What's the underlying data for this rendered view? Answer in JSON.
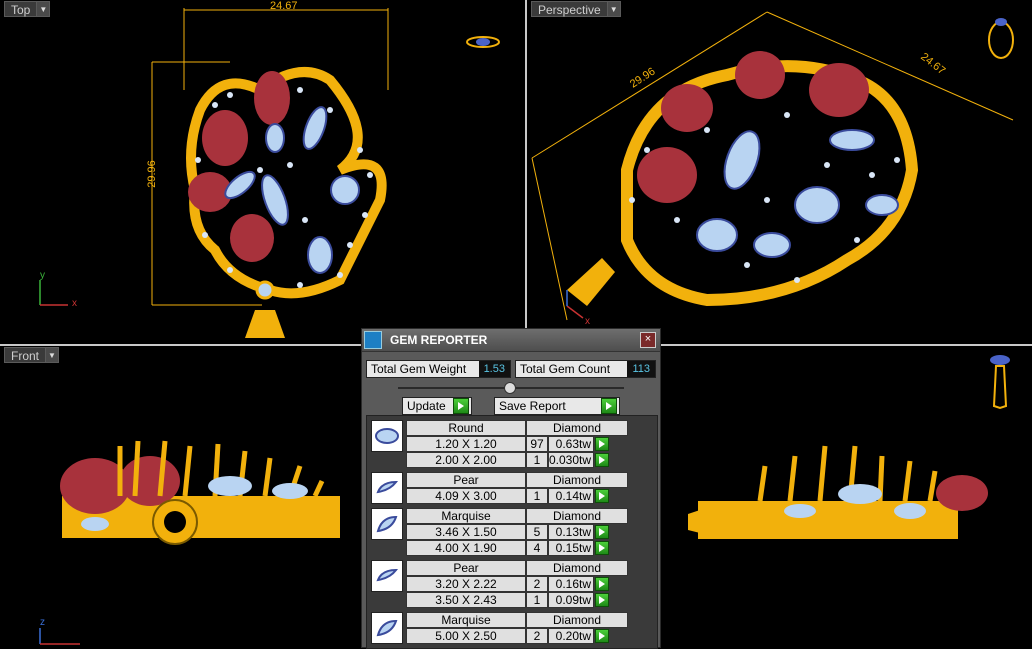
{
  "viewports": {
    "top": {
      "label": "Top",
      "dim_width": "24.67",
      "dim_height": "29.96",
      "axis_y": "y",
      "axis_x": "x"
    },
    "perspective": {
      "label": "Perspective",
      "dim_a": "29.96",
      "dim_b": "24.67",
      "axis_x": "x"
    },
    "front": {
      "label": "Front",
      "axis_z": "z"
    }
  },
  "gem_reporter": {
    "title": "GEM REPORTER",
    "close": "×",
    "total_weight_label": "Total Gem Weight",
    "total_weight_value": "1.53",
    "total_count_label": "Total Gem Count",
    "total_count_value": "113",
    "update_label": "Update",
    "save_label": "Save Report",
    "groups": [
      {
        "icon": "round-gem-icon",
        "shape": "Round",
        "material": "Diamond",
        "rows": [
          {
            "size": "1.20 X 1.20",
            "count": "97",
            "tw": "0.63tw"
          },
          {
            "size": "2.00 X 2.00",
            "count": "1",
            "tw": "0.030tw"
          }
        ]
      },
      {
        "icon": "pear-gem-icon",
        "shape": "Pear",
        "material": "Diamond",
        "rows": [
          {
            "size": "4.09 X 3.00",
            "count": "1",
            "tw": "0.14tw"
          }
        ]
      },
      {
        "icon": "marquise-gem-icon",
        "shape": "Marquise",
        "material": "Diamond",
        "rows": [
          {
            "size": "3.46 X 1.50",
            "count": "5",
            "tw": "0.13tw"
          },
          {
            "size": "4.00 X 1.90",
            "count": "4",
            "tw": "0.15tw"
          }
        ]
      },
      {
        "icon": "pear-gem-icon",
        "shape": "Pear",
        "material": "Diamond",
        "rows": [
          {
            "size": "3.20 X 2.22",
            "count": "2",
            "tw": "0.16tw"
          },
          {
            "size": "3.50 X 2.43",
            "count": "1",
            "tw": "0.09tw"
          }
        ]
      },
      {
        "icon": "marquise-gem-icon",
        "shape": "Marquise",
        "material": "Diamond",
        "rows": [
          {
            "size": "5.00 X 2.50",
            "count": "2",
            "tw": "0.20tw"
          }
        ]
      }
    ]
  },
  "colors": {
    "gold": "#f2b10c",
    "ruby": "#a8323c",
    "diamond": "#b9d4f2",
    "dimension": "#f2b10c",
    "value_text": "#59c4e4"
  }
}
